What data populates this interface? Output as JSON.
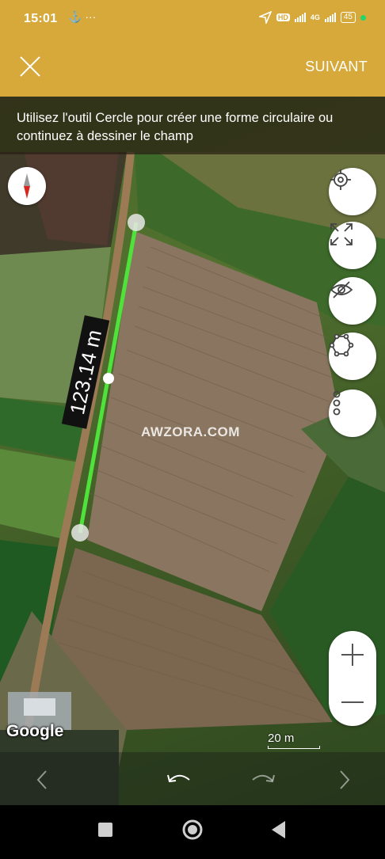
{
  "status": {
    "time": "15:01",
    "left_icons": "⚓ ···",
    "hd": "HD",
    "network": "4G",
    "battery": "45"
  },
  "toolbar": {
    "close_icon": "close-icon",
    "next_label": "SUIVANT",
    "background_color": "#d6a93a"
  },
  "map": {
    "instruction": "Utilisez l'outil Cercle pour créer une forme circulaire ou continuez à dessiner le champ",
    "measurement_label": "123.14 m",
    "watermark": "AWZORA.COM",
    "google_logo": "Google",
    "scale_label": "20 m",
    "line_color": "#4ee23b",
    "fab_icons": [
      "locate-icon",
      "fit-bounds-icon",
      "visibility-off-icon",
      "polygon-icon",
      "more-icon"
    ],
    "zoom_in_icon": "plus-icon",
    "zoom_out_icon": "minus-icon"
  },
  "bottom_controls": [
    "back-icon",
    "undo-icon",
    "redo-icon",
    "forward-icon"
  ],
  "nav": [
    "recents-icon",
    "home-icon",
    "back-icon"
  ]
}
